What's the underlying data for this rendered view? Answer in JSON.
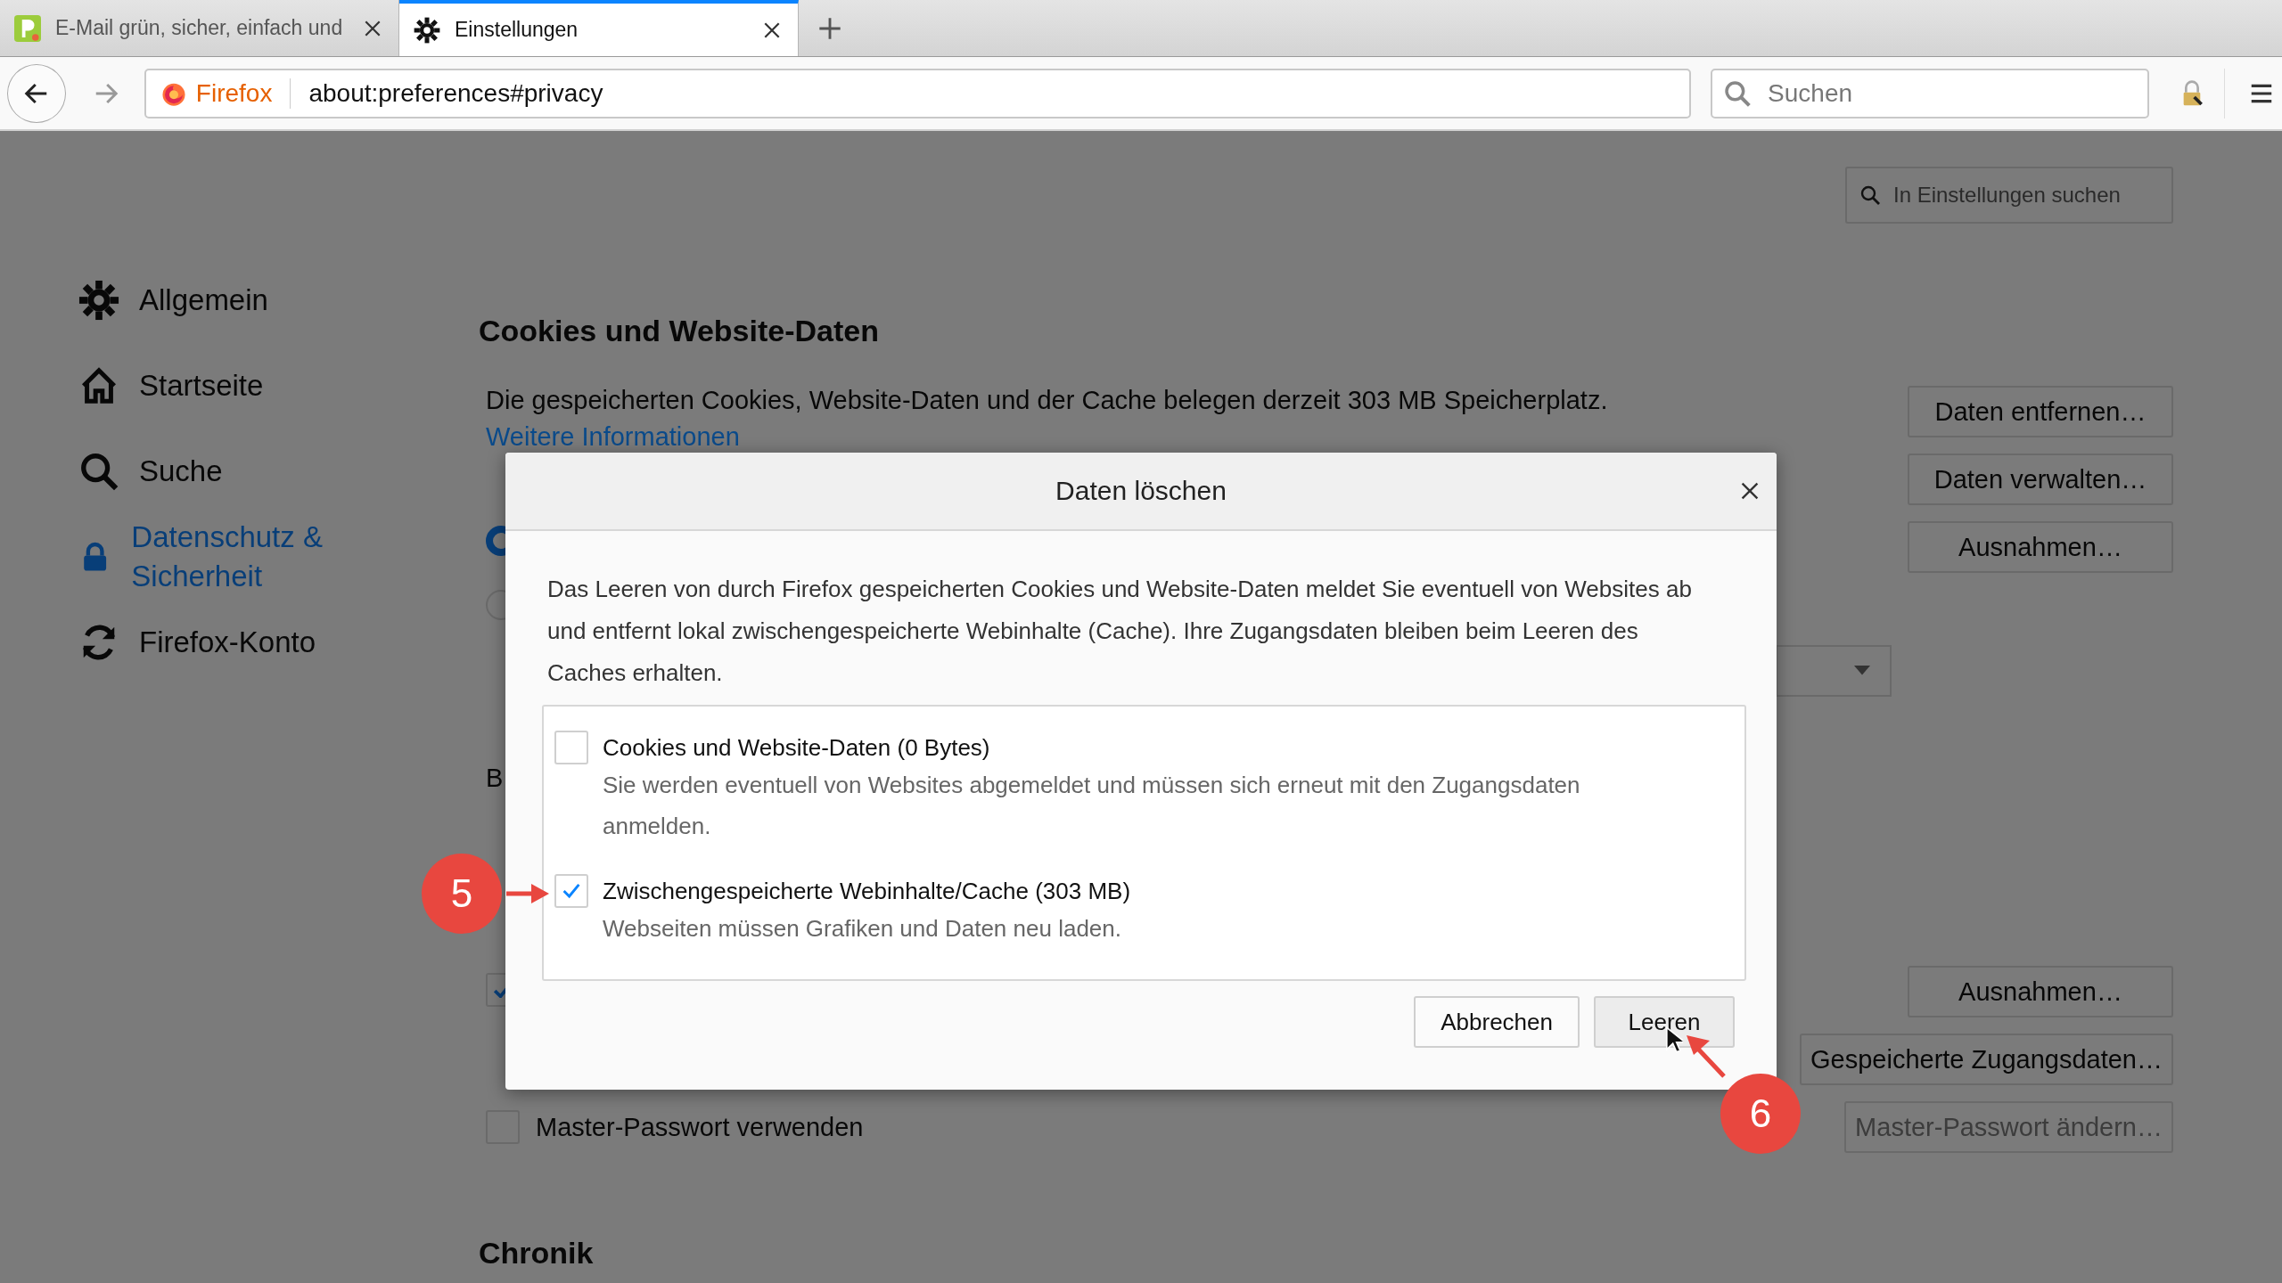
{
  "browser": {
    "tabs": [
      {
        "title": "E-Mail grün, sicher, einfach und",
        "selected": false
      },
      {
        "title": "Einstellungen",
        "selected": true
      }
    ],
    "identity": "Firefox",
    "url": "about:preferences#privacy",
    "search": {
      "placeholder": "Suchen"
    }
  },
  "settings_search": {
    "placeholder": "In Einstellungen suchen"
  },
  "sidebar": {
    "items": [
      {
        "label": "Allgemein",
        "selected": false
      },
      {
        "label": "Startseite",
        "selected": false
      },
      {
        "label": "Suche",
        "selected": false
      },
      {
        "label": "Datenschutz & Sicherheit",
        "selected": true
      },
      {
        "label": "Firefox-Konto",
        "selected": false
      }
    ]
  },
  "cookies": {
    "title": "Cookies und Website-Daten",
    "text": "Die gespeicherten Cookies, Website-Daten und der Cache belegen derzeit 303 MB Speicherplatz.",
    "link": "Weitere Informationen",
    "radios": [
      {
        "selected": true
      },
      {
        "selected": false
      }
    ],
    "buttons": [
      "Daten entfernen…",
      "Daten verwalten…",
      "Ausnahmen…"
    ]
  },
  "fragment_text": "B",
  "logins": {
    "checkbox": {
      "checked": true
    },
    "buttons": [
      {
        "label": "Ausnahmen…",
        "disabled": false
      },
      {
        "label": "Gespeicherte Zugangsdaten…",
        "disabled": false
      },
      {
        "label": "Master-Passwort ändern…",
        "disabled": true
      }
    ],
    "master_password": {
      "label": "Master-Passwort verwenden",
      "checked": false
    }
  },
  "next_section": "Chronik",
  "dialog": {
    "title": "Daten löschen",
    "text": "Das Leeren von durch Firefox gespeicherten Cookies und Website-Daten meldet Sie eventuell von Websites ab und entfernt lokal zwischengespeicherte Webinhalte (Cache). Ihre Zugangsdaten bleiben beim Leeren des Caches erhalten.",
    "items": [
      {
        "label": "Cookies und Website-Daten (0 Bytes)",
        "description": "Sie werden eventuell von Websites abgemeldet und müssen sich erneut mit den Zugangsdaten anmelden.",
        "checked": false
      },
      {
        "label": "Zwischengespeicherte Webinhalte/Cache (303 MB)",
        "description": "Webseiten müssen Grafiken und Daten neu laden.",
        "checked": true
      }
    ],
    "buttons": [
      "Abbrechen",
      "Leeren"
    ]
  },
  "annotations": [
    {
      "label": "5"
    },
    {
      "label": "6"
    }
  ]
}
